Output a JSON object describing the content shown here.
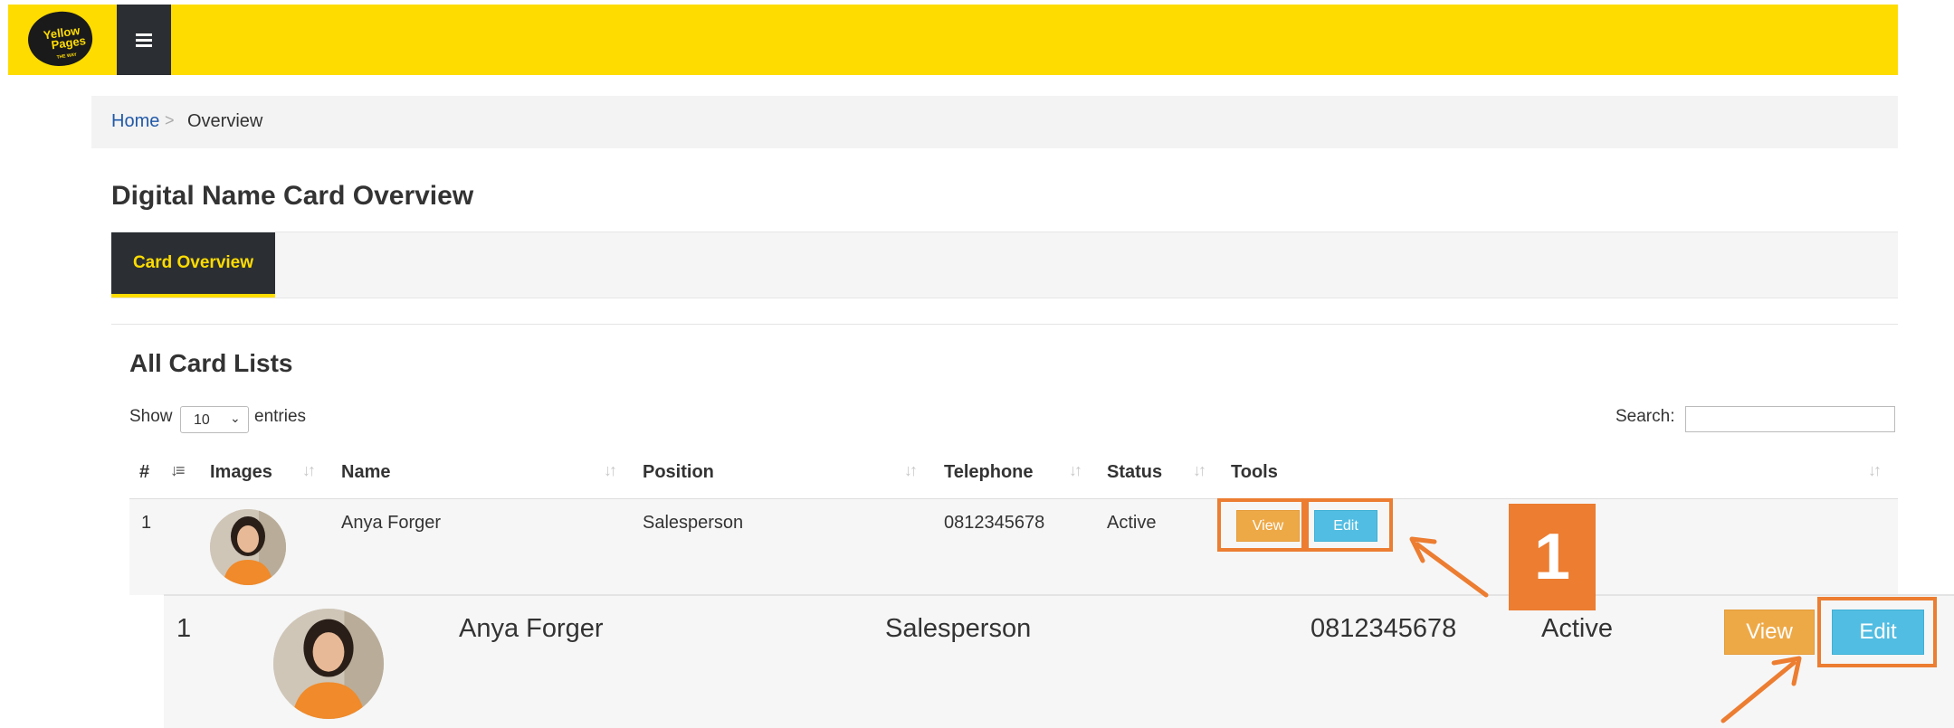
{
  "brand": {
    "logo_line1": "Yellow",
    "logo_line2": "Pages",
    "logo_tag": "THE WAY"
  },
  "breadcrumb": {
    "home": "Home",
    "separator": ">",
    "current": "Overview"
  },
  "page_title": "Digital Name Card Overview",
  "tabs": [
    {
      "label": "Card Overview",
      "active": true
    }
  ],
  "section_title": "All Card Lists",
  "length_menu": {
    "show": "Show",
    "value": "10",
    "entries": "entries"
  },
  "search": {
    "label": "Search:",
    "value": ""
  },
  "table": {
    "columns": [
      "#",
      "Images",
      "Name",
      "Position",
      "Telephone",
      "Status",
      "Tools"
    ],
    "rows": [
      {
        "no": "1",
        "name": "Anya Forger",
        "position": "Salesperson",
        "telephone": "0812345678",
        "status": "Active",
        "view": "View",
        "edit": "Edit"
      }
    ]
  },
  "zoom": {
    "no": "1",
    "name": "Anya Forger",
    "position": "Salesperson",
    "telephone": "0812345678",
    "status": "Active",
    "view": "View",
    "edit": "Edit"
  },
  "callout": {
    "step": "1"
  },
  "colors": {
    "brand_yellow": "#ffdc00",
    "dark": "#2b2f33",
    "view": "#eea947",
    "edit": "#52bde2",
    "highlight": "#ec7d31",
    "link": "#2159a8"
  },
  "icons": {
    "menu": "hamburger-icon",
    "sort": "sort-icon",
    "select": "chevron-down-icon"
  }
}
